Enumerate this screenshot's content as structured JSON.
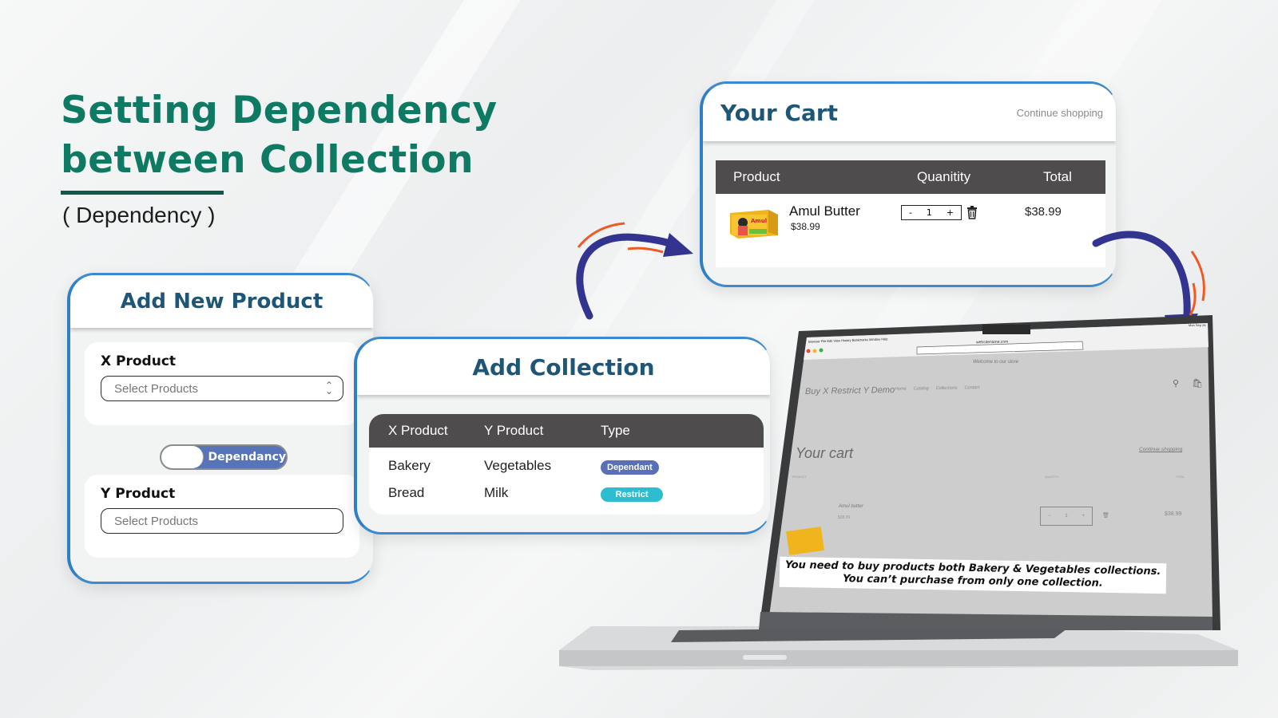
{
  "hero": {
    "title_line1": "Setting Dependency",
    "title_line2": "between Collection",
    "subtitle": "( Dependency )"
  },
  "colors": {
    "title_green": "#0f7a64",
    "card_title_blue": "#1d5676",
    "card_border": "#2f7fc8",
    "table_header": "#4e4c4c",
    "toggle_bg": "#5774b9",
    "badge_dependant": "#5a6fb6",
    "badge_restrict": "#2ebdd0",
    "arrow_blue": "#33348f",
    "arrow_orange": "#f05a22"
  },
  "add_product": {
    "title": "Add New Product",
    "x_label": "X Product",
    "x_placeholder": "Select Products",
    "toggle_label": "Dependancy",
    "y_label": "Y Product",
    "y_placeholder": "Select Products"
  },
  "add_collection": {
    "title": "Add Collection",
    "columns": [
      "X Product",
      "Y Product",
      "Type"
    ],
    "rows": [
      {
        "x": "Bakery",
        "y": "Vegetables",
        "type": "Dependant"
      },
      {
        "x": "Bread",
        "y": "Milk",
        "type": "Restrict"
      }
    ]
  },
  "cart": {
    "title": "Your Cart",
    "continue_label": "Continue shopping",
    "columns": [
      "Product",
      "Quanitity",
      "Total"
    ],
    "item": {
      "name": "Amul Butter",
      "price": "$38.99",
      "qty_minus": "-",
      "qty": "1",
      "qty_plus": "+",
      "total": "$38.99"
    }
  },
  "laptop": {
    "menubar": [
      "Browser",
      "File",
      "Edit",
      "View",
      "History",
      "Bookmarks",
      "Window",
      "Help"
    ],
    "clock": "Mon Sep 26",
    "url": "websitename.com",
    "announcement": "Welcome to our store",
    "store_name": "Buy X Restrict Y Demo",
    "nav": [
      "Home",
      "Catalog",
      "Collections",
      "Contact"
    ],
    "cart_title": "Your cart",
    "continue_label": "Continue shopping",
    "col_product": "PRODUCT",
    "col_quantity": "QUANTITY",
    "col_total": "TOTAL",
    "item_name": "Amul butter",
    "item_price": "$38.99",
    "qty_minus": "−",
    "qty": "1",
    "qty_plus": "+",
    "item_total": "$38.99",
    "message_line1": "You need to buy products both Bakery & Vegetables collections.",
    "message_line2": "You can’t purchase from only one collection."
  }
}
